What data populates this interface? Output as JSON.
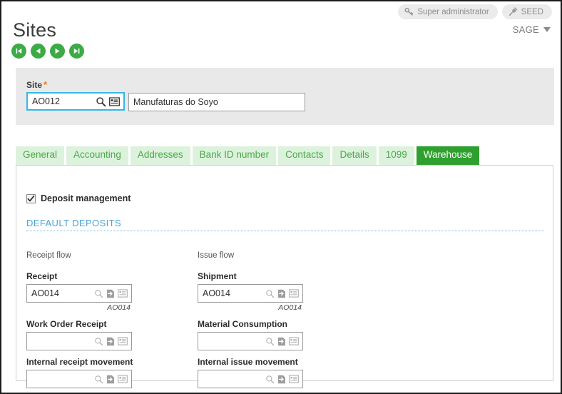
{
  "topbar": {
    "badges": [
      {
        "label": "Super administrator",
        "icon": "key-icon"
      },
      {
        "label": "SEED",
        "icon": "plug-icon"
      }
    ],
    "menu_label": "SAGE",
    "menu_icon": "chevron-down-icon"
  },
  "header": {
    "title": "Sites",
    "nav": [
      {
        "name": "first-record-button",
        "icon": "first-icon"
      },
      {
        "name": "previous-record-button",
        "icon": "previous-icon"
      },
      {
        "name": "next-record-button",
        "icon": "next-icon"
      },
      {
        "name": "last-record-button",
        "icon": "last-icon"
      }
    ]
  },
  "site_panel": {
    "label": "Site",
    "required_marker": "*",
    "code_value": "AO012",
    "code_placeholder": "",
    "name_value": "Manufaturas do Soyo",
    "name_placeholder": ""
  },
  "tabs": [
    {
      "label": "General",
      "active": false
    },
    {
      "label": "Accounting",
      "active": false
    },
    {
      "label": "Addresses",
      "active": false
    },
    {
      "label": "Bank ID number",
      "active": false
    },
    {
      "label": "Contacts",
      "active": false
    },
    {
      "label": "Details",
      "active": false
    },
    {
      "label": "1099",
      "active": false
    },
    {
      "label": "Warehouse",
      "active": true
    }
  ],
  "content": {
    "deposit_management": {
      "label": "Deposit management",
      "checked": true
    },
    "section_title": "DEFAULT DEPOSITS",
    "left_column": {
      "flow_label": "Receipt flow",
      "fields": [
        {
          "label": "Receipt",
          "value": "AO014",
          "hint": "AO014"
        },
        {
          "label": "Work Order Receipt",
          "value": "",
          "hint": ""
        },
        {
          "label": "Internal receipt movement",
          "value": "",
          "hint": ""
        }
      ]
    },
    "right_column": {
      "flow_label": "Issue flow",
      "fields": [
        {
          "label": "Shipment",
          "value": "AO014",
          "hint": "AO014"
        },
        {
          "label": "Material Consumption",
          "value": "",
          "hint": ""
        },
        {
          "label": "Internal issue movement",
          "value": "",
          "hint": ""
        }
      ]
    }
  },
  "colors": {
    "brand_green": "#2fa02f",
    "tab_green_bg": "#ddf2dd",
    "tab_green_text": "#4aa94a",
    "accent_blue": "#4aa3d8",
    "focus_blue": "#35b6e8",
    "required_orange": "#f07d20",
    "panel_gray": "#e9e9e9"
  }
}
